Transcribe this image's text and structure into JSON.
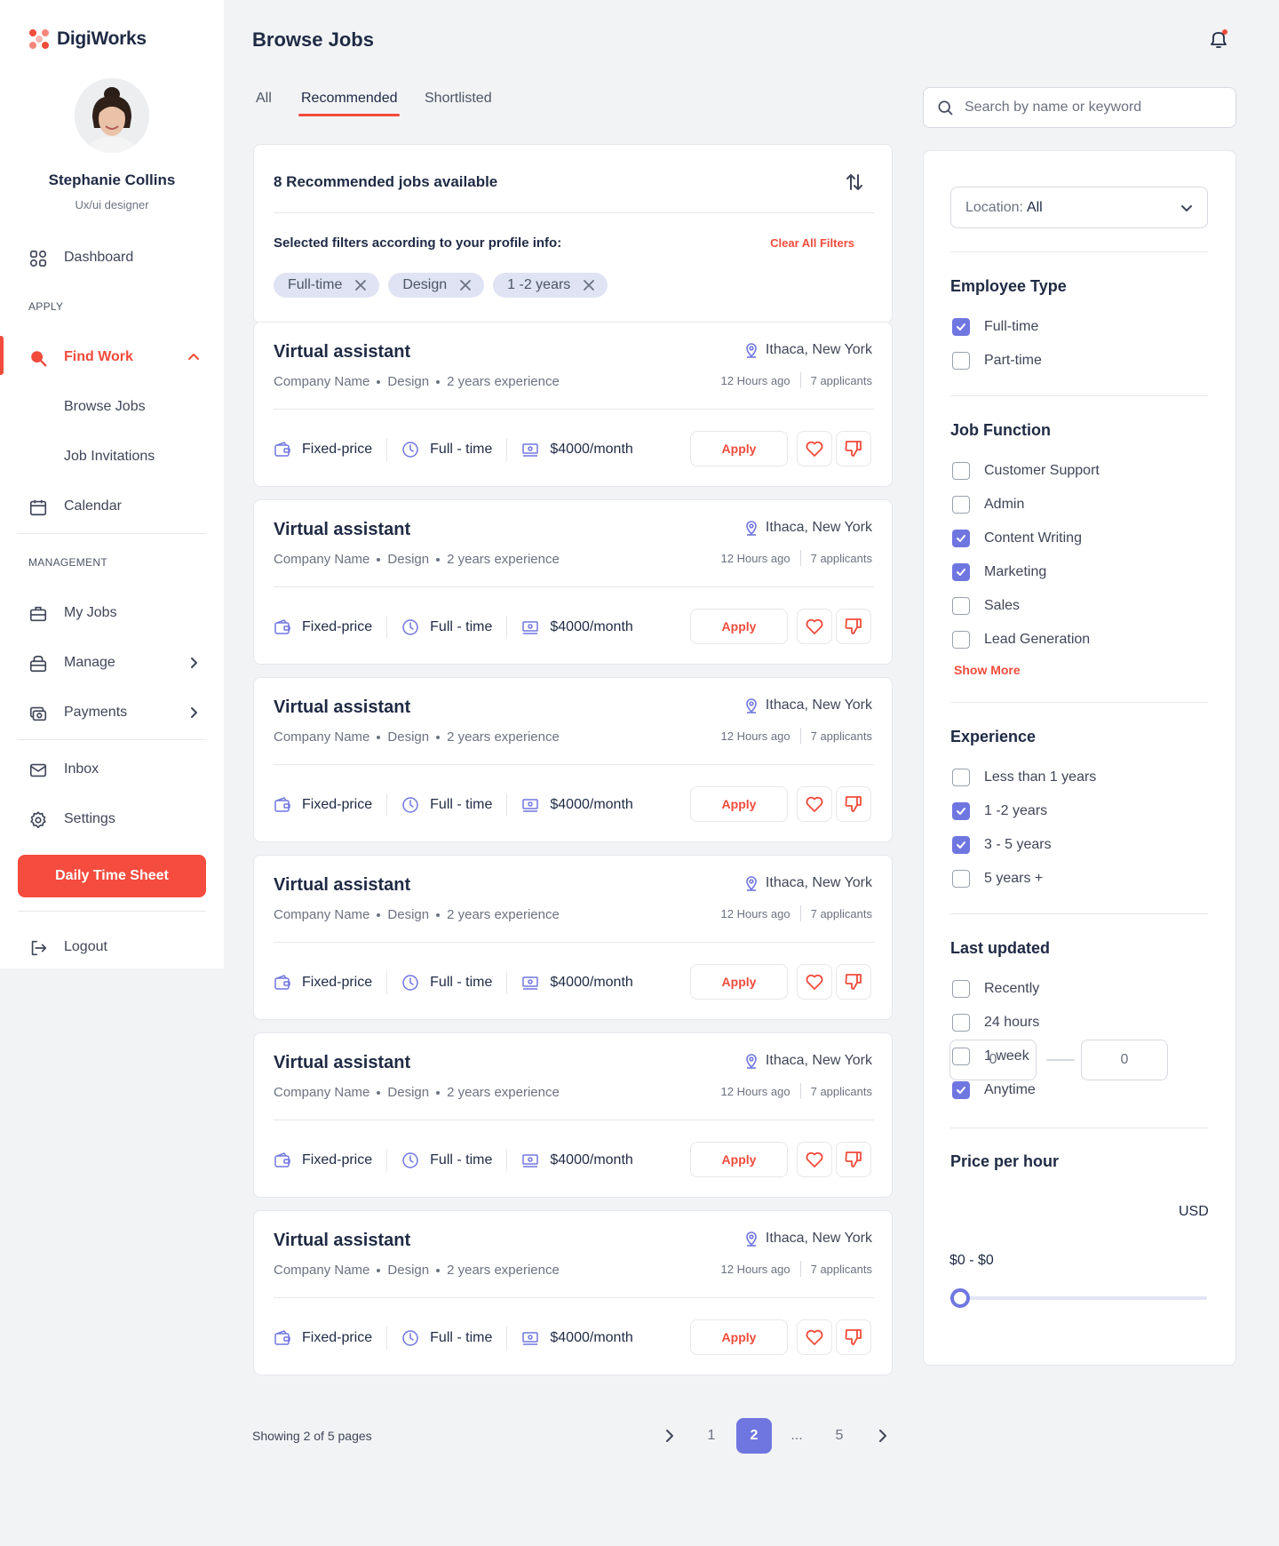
{
  "app": {
    "name": "DigiWorks"
  },
  "user": {
    "name": "Stephanie Collins",
    "role": "Ux/ui designer"
  },
  "nav": {
    "dashboard": "Dashboard",
    "section_apply": "APPLY",
    "find_work": "Find Work",
    "browse_jobs": "Browse Jobs",
    "job_invitations": "Job Invitations",
    "calendar": "Calendar",
    "section_management": "MANAGEMENT",
    "my_jobs": "My Jobs",
    "manage": "Manage",
    "payments": "Payments",
    "inbox": "Inbox",
    "settings": "Settings",
    "daily_time_sheet": "Daily Time Sheet",
    "logout": "Logout"
  },
  "header": {
    "title": "Browse Jobs"
  },
  "tabs": [
    {
      "label": "All"
    },
    {
      "label": "Recommended"
    },
    {
      "label": "Shortlisted"
    }
  ],
  "search": {
    "placeholder": "Search by name or keyword"
  },
  "summary": {
    "title": "8 Recommended jobs available",
    "filters_label": "Selected filters according to your profile info:",
    "clear_all": "Clear All Filters",
    "chips": [
      "Full-time",
      "Design",
      "1 -2 years"
    ]
  },
  "jobs": [
    {
      "title": "Virtual assistant",
      "company": "Company Name",
      "category": "Design",
      "experience": "2 years experience",
      "location": "Ithaca, New York",
      "posted": "12 Hours ago",
      "applicants": "7 applicants",
      "price_type": "Fixed-price",
      "employment": "Full - time",
      "salary": "$4000/month",
      "apply_label": "Apply"
    },
    {
      "title": "Virtual assistant",
      "company": "Company Name",
      "category": "Design",
      "experience": "2 years experience",
      "location": "Ithaca, New York",
      "posted": "12 Hours ago",
      "applicants": "7 applicants",
      "price_type": "Fixed-price",
      "employment": "Full - time",
      "salary": "$4000/month",
      "apply_label": "Apply"
    },
    {
      "title": "Virtual assistant",
      "company": "Company Name",
      "category": "Design",
      "experience": "2 years experience",
      "location": "Ithaca, New York",
      "posted": "12 Hours ago",
      "applicants": "7 applicants",
      "price_type": "Fixed-price",
      "employment": "Full - time",
      "salary": "$4000/month",
      "apply_label": "Apply"
    },
    {
      "title": "Virtual assistant",
      "company": "Company Name",
      "category": "Design",
      "experience": "2 years experience",
      "location": "Ithaca, New York",
      "posted": "12 Hours ago",
      "applicants": "7 applicants",
      "price_type": "Fixed-price",
      "employment": "Full - time",
      "salary": "$4000/month",
      "apply_label": "Apply"
    },
    {
      "title": "Virtual assistant",
      "company": "Company Name",
      "category": "Design",
      "experience": "2 years experience",
      "location": "Ithaca, New York",
      "posted": "12 Hours ago",
      "applicants": "7 applicants",
      "price_type": "Fixed-price",
      "employment": "Full - time",
      "salary": "$4000/month",
      "apply_label": "Apply"
    },
    {
      "title": "Virtual assistant",
      "company": "Company Name",
      "category": "Design",
      "experience": "2 years experience",
      "location": "Ithaca, New York",
      "posted": "12 Hours ago",
      "applicants": "7 applicants",
      "price_type": "Fixed-price",
      "employment": "Full - time",
      "salary": "$4000/month",
      "apply_label": "Apply"
    }
  ],
  "pagination": {
    "summary": "Showing 2 of 5 pages",
    "pages": [
      "1",
      "2",
      "...",
      "5"
    ],
    "current": "2"
  },
  "filters": {
    "location": {
      "label": "Location:",
      "value": "All"
    },
    "employee_type": {
      "title": "Employee Type",
      "options": [
        {
          "label": "Full-time",
          "checked": true
        },
        {
          "label": "Part-time",
          "checked": false
        }
      ]
    },
    "job_function": {
      "title": "Job Function",
      "options": [
        {
          "label": "Customer Support",
          "checked": false
        },
        {
          "label": "Admin",
          "checked": false
        },
        {
          "label": "Content Writing",
          "checked": true
        },
        {
          "label": "Marketing",
          "checked": true
        },
        {
          "label": "Sales",
          "checked": false
        },
        {
          "label": "Lead Generation",
          "checked": false
        }
      ],
      "show_more": "Show More"
    },
    "experience": {
      "title": "Experience",
      "options": [
        {
          "label": "Less than 1 years",
          "checked": false
        },
        {
          "label": "1 -2 years",
          "checked": true
        },
        {
          "label": "3 - 5 years",
          "checked": true
        },
        {
          "label": "5 years +",
          "checked": false
        }
      ]
    },
    "last_updated": {
      "title": "Last updated",
      "options": [
        {
          "label": "Recently",
          "checked": false
        },
        {
          "label": "24 hours",
          "checked": false
        },
        {
          "label": "1 week",
          "checked": false
        },
        {
          "label": "Anytime",
          "checked": true
        }
      ]
    },
    "price": {
      "title": "Price per hour",
      "min": "0",
      "max": "0",
      "currency": "USD",
      "range_label": "$0 - $0",
      "slider_value": 0
    }
  },
  "colors": {
    "accent": "#f04b3b",
    "primary": "#7076e0",
    "text": "#1f2a44"
  }
}
